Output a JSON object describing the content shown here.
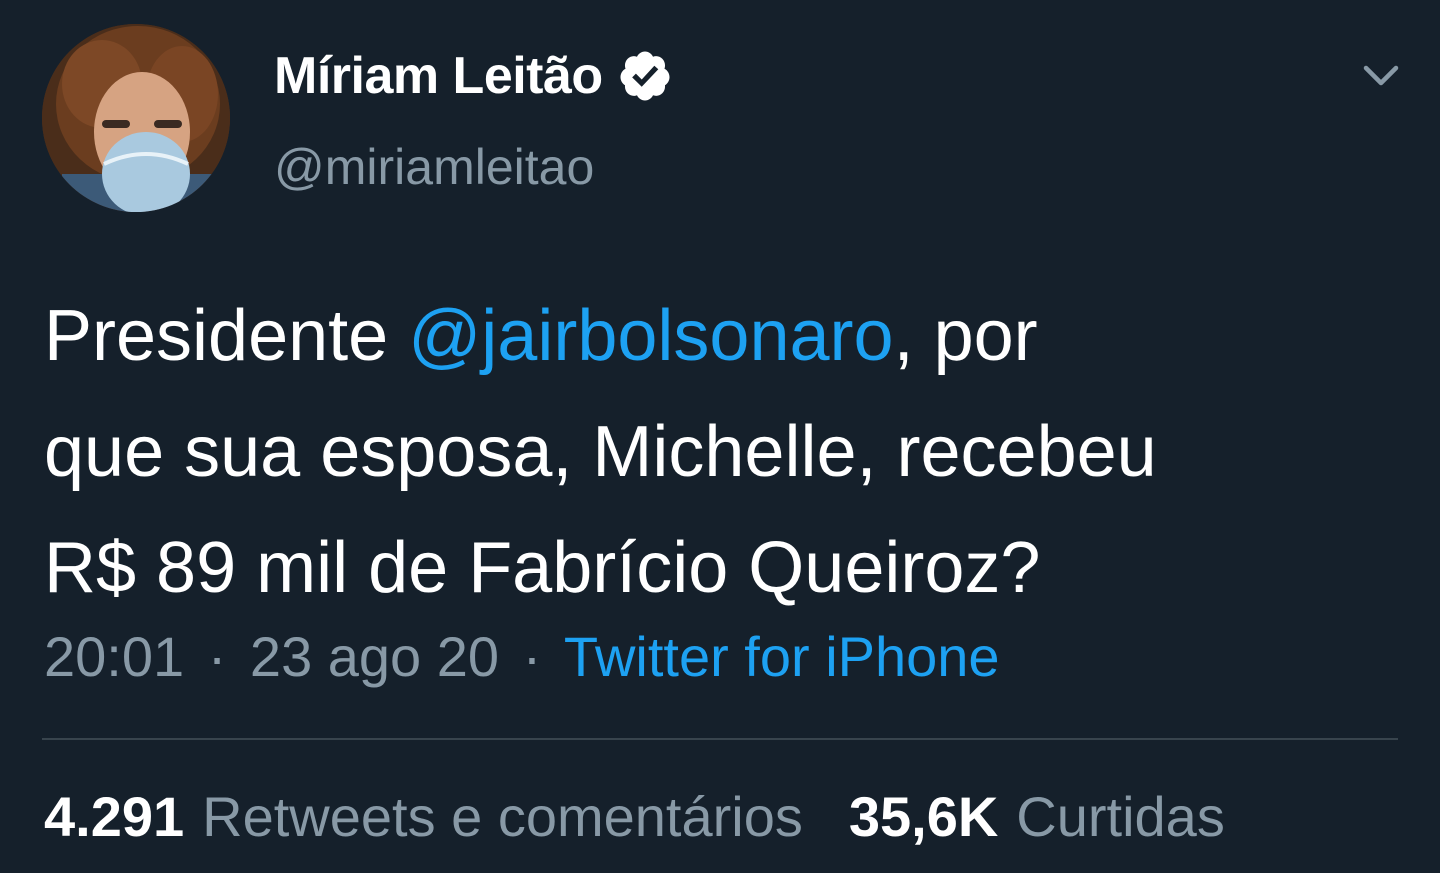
{
  "author": {
    "display_name": "Míriam Leitão",
    "handle": "@miriamleitao",
    "verified": true,
    "verified_icon": "verified-badge-icon",
    "avatar": "profile-photo"
  },
  "menu": {
    "icon": "chevron-down-icon"
  },
  "tweet": {
    "line1_pre": "Presidente ",
    "mention": "@jairbolsonaro",
    "line1_post": ", por",
    "line2": "que sua esposa, Michelle, recebeu",
    "line3": "R$ 89 mil de Fabrício Queiroz?"
  },
  "meta": {
    "time": "20:01",
    "separator": "·",
    "date": "23 ago 20",
    "source": "Twitter for iPhone"
  },
  "stats": {
    "retweets_count": "4.291",
    "retweets_label": "Retweets e comentários",
    "likes_count": "35,6K",
    "likes_label": "Curtidas"
  },
  "colors": {
    "background": "#15202b",
    "text": "#ffffff",
    "secondary": "#8899a6",
    "accent": "#1da1f2",
    "divider": "#38444d"
  }
}
